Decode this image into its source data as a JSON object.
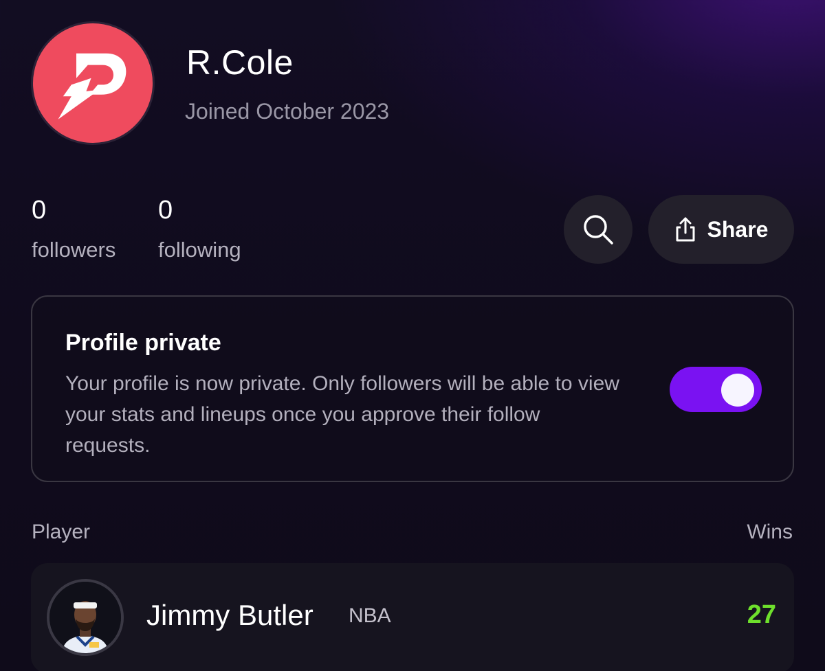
{
  "profile": {
    "username": "R.Cole",
    "joined": "Joined October 2023",
    "avatar_icon": "prizepicks-logo-icon",
    "avatar_color": "#ef4b5e"
  },
  "stats": {
    "followers_count": "0",
    "followers_label": "followers",
    "following_count": "0",
    "following_label": "following"
  },
  "actions": {
    "search_icon": "search-icon",
    "share_icon": "share-icon",
    "share_label": "Share"
  },
  "privacy": {
    "title": "Profile private",
    "description": "Your profile is now private. Only followers will be able to view your stats and lineups once you approve their follow requests.",
    "toggle_on": true,
    "toggle_color": "#7a12f2"
  },
  "list": {
    "col_player": "Player",
    "col_wins": "Wins",
    "rows": [
      {
        "name": "Jimmy Butler",
        "league": "NBA",
        "wins": "27",
        "wins_color": "#6ee02c"
      }
    ]
  }
}
